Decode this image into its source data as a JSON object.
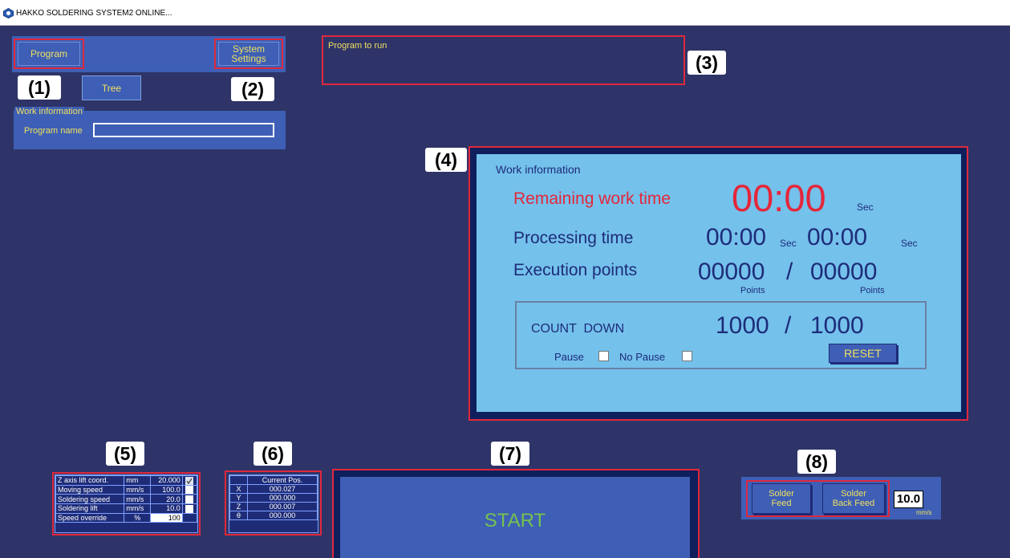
{
  "window": {
    "title": "HAKKO SOLDERING SYSTEM2 ONLINE..."
  },
  "top_panel": {
    "program_label": "Program",
    "system_settings_line1": "System",
    "system_settings_line2": "Settings",
    "tree_label": "Tree"
  },
  "work_info_left": {
    "legend": "Work information",
    "program_name_label": "Program name",
    "program_name_value": ""
  },
  "program_to_run": {
    "label": "Program to run"
  },
  "callouts": [
    "(1)",
    "(2)",
    "(3)",
    "(4)",
    "(5)",
    "(6)",
    "(7)",
    "(8)"
  ],
  "work_panel": {
    "title": "Work information",
    "remaining_label": "Remaining work time",
    "remaining_value": "00:00",
    "remaining_unit": "Sec",
    "processing_label": "Processing time",
    "processing_value1": "00:00",
    "processing_unit1": "Sec",
    "processing_value2": "00:00",
    "processing_unit2": "Sec",
    "execution_label": "Execution points",
    "execution_value1": "00000",
    "execution_separator": "/",
    "execution_value2": "00000",
    "points_unit1": "Points",
    "points_unit2": "Points",
    "countdown_label": "COUNT  DOWN",
    "countdown_value1": "1000",
    "countdown_separator": "/",
    "countdown_value2": "1000",
    "pause_label": "Pause",
    "nopause_label": "No Pause",
    "reset_label": "RESET"
  },
  "settings_table": {
    "rows": [
      {
        "label": "Z axis lift coord.",
        "unit": "mm",
        "value": "20.000",
        "checked": true
      },
      {
        "label": "Moving speed",
        "unit": "mm/s",
        "value": "100.0",
        "checked": false
      },
      {
        "label": "Soldering speed",
        "unit": "mm/s",
        "value": "20.0",
        "checked": false
      },
      {
        "label": "Soldering lift",
        "unit": "mm/s",
        "value": "10.0",
        "checked": false
      },
      {
        "label": "Speed override",
        "unit": "%",
        "value": "100",
        "checked": null
      }
    ]
  },
  "position_table": {
    "header": "Current Pos.",
    "rows": [
      {
        "axis": "X",
        "value": "000.027"
      },
      {
        "axis": "Y",
        "value": "000.000"
      },
      {
        "axis": "Z",
        "value": "000.007"
      },
      {
        "axis": "θ",
        "value": "000.000"
      }
    ]
  },
  "start": {
    "label": "START"
  },
  "solder": {
    "feed_line1": "Solder",
    "feed_line2": "Feed",
    "back_line1": "Solder",
    "back_line2": "Back Feed",
    "rate_value": "10.0",
    "rate_unit": "mm/s"
  },
  "colors": {
    "background": "#2e3468",
    "panel_blue": "#3e5fb5",
    "info_panel": "#74c1ec",
    "highlight_red": "#e0283c",
    "label_yellow": "#f0e060",
    "start_green": "#75c250"
  }
}
